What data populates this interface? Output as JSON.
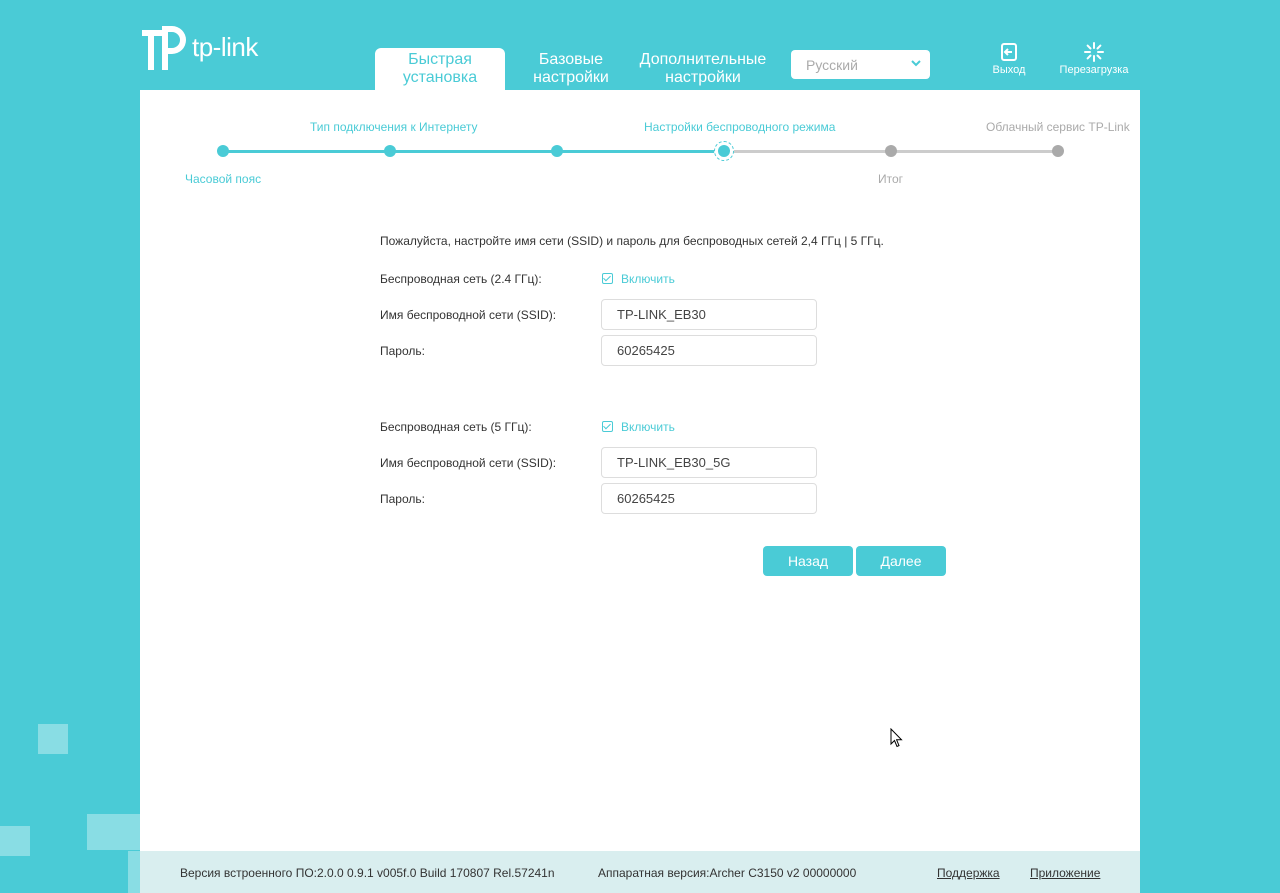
{
  "header": {
    "logo_text": "tp-link",
    "tabs": [
      {
        "line1": "Быстрая",
        "line2": "установка"
      },
      {
        "line1": "Базовые",
        "line2": "настройки"
      },
      {
        "line1": "Дополнительные",
        "line2": "настройки"
      }
    ],
    "language": "Русский",
    "logout_label": "Выход",
    "reboot_label": "Перезагрузка"
  },
  "progress": {
    "steps_top": [
      "Тип подключения к Интернету",
      "Настройки беспроводного режима",
      "Облачный сервис TP-Link"
    ],
    "steps_bottom": [
      "Часовой пояс",
      "Итог"
    ]
  },
  "form": {
    "intro": "Пожалуйста, настройте имя сети (SSID) и пароль для беспроводных сетей 2,4 ГГц | 5 ГГц.",
    "band24": {
      "label": "Беспроводная сеть (2.4 ГГц):",
      "enable_label": "Включить",
      "ssid_label": "Имя беспроводной сети (SSID):",
      "ssid_value": "TP-LINK_EB30",
      "password_label": "Пароль:",
      "password_value": "60265425"
    },
    "band5": {
      "label": "Беспроводная сеть (5 ГГц):",
      "enable_label": "Включить",
      "ssid_label": "Имя беспроводной сети (SSID):",
      "ssid_value": "TP-LINK_EB30_5G",
      "password_label": "Пароль:",
      "password_value": "60265425"
    },
    "back_label": "Назад",
    "next_label": "Далее"
  },
  "footer": {
    "firmware": "Версия встроенного ПО:2.0.0 0.9.1 v005f.0 Build 170807 Rel.57241n",
    "hardware": "Аппаратная версия:Archer C3150 v2 00000000",
    "support": "Поддержка",
    "app": "Приложение"
  },
  "colors": {
    "accent": "#4acbd6",
    "inactive": "#aaaaaa"
  }
}
